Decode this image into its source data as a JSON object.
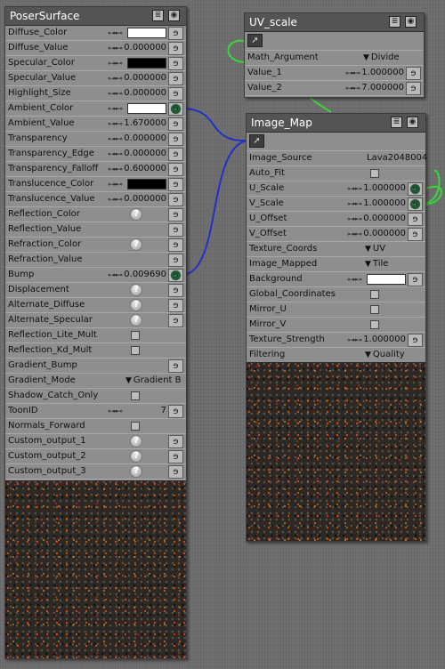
{
  "nodes": {
    "poser_surface": {
      "title": "PoserSurface",
      "rows": [
        {
          "label": "Diffuse_Color",
          "kind": "color",
          "color": "#ffffff"
        },
        {
          "label": "Diffuse_Value",
          "kind": "value",
          "value": "0.000000"
        },
        {
          "label": "Specular_Color",
          "kind": "color",
          "color": "#000000"
        },
        {
          "label": "Specular_Value",
          "kind": "value",
          "value": "0.000000"
        },
        {
          "label": "Highlight_Size",
          "kind": "value",
          "value": "0.000000"
        },
        {
          "label": "Ambient_Color",
          "kind": "color",
          "color": "#ffffff",
          "connected": true
        },
        {
          "label": "Ambient_Value",
          "kind": "value",
          "value": "1.670000"
        },
        {
          "label": "Transparency",
          "kind": "value",
          "value": "0.000000"
        },
        {
          "label": "Transparency_Edge",
          "kind": "value",
          "value": "0.000000"
        },
        {
          "label": "Transparency_Falloff",
          "kind": "value",
          "value": "0.600000"
        },
        {
          "label": "Translucence_Color",
          "kind": "color",
          "color": "#000000"
        },
        {
          "label": "Translucence_Value",
          "kind": "value",
          "value": "0.000000"
        },
        {
          "label": "Reflection_Color",
          "kind": "help"
        },
        {
          "label": "Reflection_Value",
          "kind": "link"
        },
        {
          "label": "Refraction_Color",
          "kind": "help"
        },
        {
          "label": "Refraction_Value",
          "kind": "link"
        },
        {
          "label": "Bump",
          "kind": "value",
          "value": "0.009690",
          "connected": true
        },
        {
          "label": "Displacement",
          "kind": "help"
        },
        {
          "label": "Alternate_Diffuse",
          "kind": "help"
        },
        {
          "label": "Alternate_Specular",
          "kind": "help"
        },
        {
          "label": "Reflection_Lite_Mult",
          "kind": "check"
        },
        {
          "label": "Reflection_Kd_Mult",
          "kind": "check"
        },
        {
          "label": "Gradient_Bump",
          "kind": "link"
        },
        {
          "label": "Gradient_Mode",
          "kind": "dropdown",
          "value": "Gradient B"
        },
        {
          "label": "Shadow_Catch_Only",
          "kind": "check"
        },
        {
          "label": "ToonID",
          "kind": "value",
          "value": "7"
        },
        {
          "label": "Normals_Forward",
          "kind": "check"
        },
        {
          "label": "Custom_output_1",
          "kind": "help"
        },
        {
          "label": "Custom_output_2",
          "kind": "help"
        },
        {
          "label": "Custom_output_3",
          "kind": "help"
        }
      ]
    },
    "uv_scale": {
      "title": "UV_scale",
      "rows": [
        {
          "label": "Math_Argument",
          "kind": "dropdown",
          "value": "Divide"
        },
        {
          "label": "Value_1",
          "kind": "value",
          "value": "1.000000"
        },
        {
          "label": "Value_2",
          "kind": "value",
          "value": "7.000000"
        }
      ]
    },
    "image_map": {
      "title": "Image_Map",
      "rows": [
        {
          "label": "Image_Source",
          "kind": "text",
          "value": "Lava2048004"
        },
        {
          "label": "Auto_Fit",
          "kind": "check"
        },
        {
          "label": "U_Scale",
          "kind": "value",
          "value": "1.000000",
          "connected": true
        },
        {
          "label": "V_Scale",
          "kind": "value",
          "value": "1.000000",
          "connected": true
        },
        {
          "label": "U_Offset",
          "kind": "value",
          "value": "0.000000"
        },
        {
          "label": "V_Offset",
          "kind": "value",
          "value": "0.000000"
        },
        {
          "label": "Texture_Coords",
          "kind": "dropdown",
          "value": "UV"
        },
        {
          "label": "Image_Mapped",
          "kind": "dropdown",
          "value": "Tile"
        },
        {
          "label": "Background",
          "kind": "color",
          "color": "#ffffff"
        },
        {
          "label": "Global_Coordinates",
          "kind": "check"
        },
        {
          "label": "Mirror_U",
          "kind": "check"
        },
        {
          "label": "Mirror_V",
          "kind": "check"
        },
        {
          "label": "Texture_Strength",
          "kind": "value",
          "value": "1.000000"
        },
        {
          "label": "Filtering",
          "kind": "dropdown",
          "value": "Quality"
        }
      ]
    }
  },
  "colors": {
    "blue_wire": "#2430c8",
    "green_wire": "#39d839",
    "node_body": "#8e8e8e",
    "title_bar": "#545454"
  },
  "icons": {
    "menu": "list-icon",
    "eye": "eye-icon",
    "link": "plug-icon",
    "chain": "chain-link-icon",
    "help": "question-icon",
    "pointer": "cursor-arrow-icon"
  },
  "symbols": {
    "chain": "⊶⊷",
    "plug": "ɘ",
    "help": "?",
    "tri": "▼",
    "menu": "≣",
    "eye": "◉",
    "cursor": "➚"
  }
}
